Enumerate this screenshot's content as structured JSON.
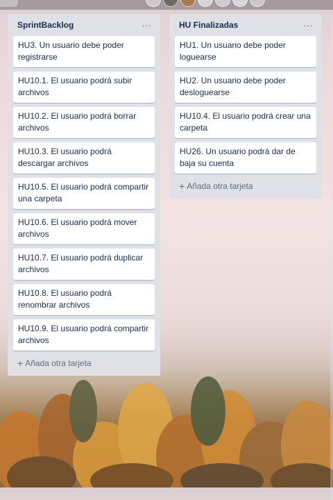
{
  "colors": {
    "list_bg": "#dfe1e6",
    "card_bg": "#ffffff",
    "text": "#172b4d",
    "muted": "#5e6c84"
  },
  "lists": [
    {
      "title": "SprintBacklog",
      "menu_icon": "more-horizontal-icon",
      "cards": [
        "HU3. Un usuario debe poder registrarse",
        "HU10.1. El usuario podrá subir archivos",
        "HU10.2. El usuario podrá borrar archivos",
        "HU10.3. El usuario podrá descargar archivos",
        "HU10.5. El usuario podrá compartir una carpeta",
        "HU10.6. El usuario podrá mover archivos",
        "HU10.7. El usuario podrá duplicar archivos",
        "HU10.8. El usuario podrá renombrar archivos",
        "HU10.9. El usuario podrá compartir archivos"
      ],
      "add_card_label": "Añada otra tarjeta"
    },
    {
      "title": "HU Finalizadas",
      "menu_icon": "more-horizontal-icon",
      "cards": [
        "HU1. Un usuario debe poder loguearse",
        "HU2. Un usuario debe poder desloguearse",
        "HU10.4. El usuario podrá crear una carpeta",
        "HU26. Un usuario podrá dar de baja su cuenta"
      ],
      "add_card_label": "Añada otra tarjeta"
    }
  ]
}
